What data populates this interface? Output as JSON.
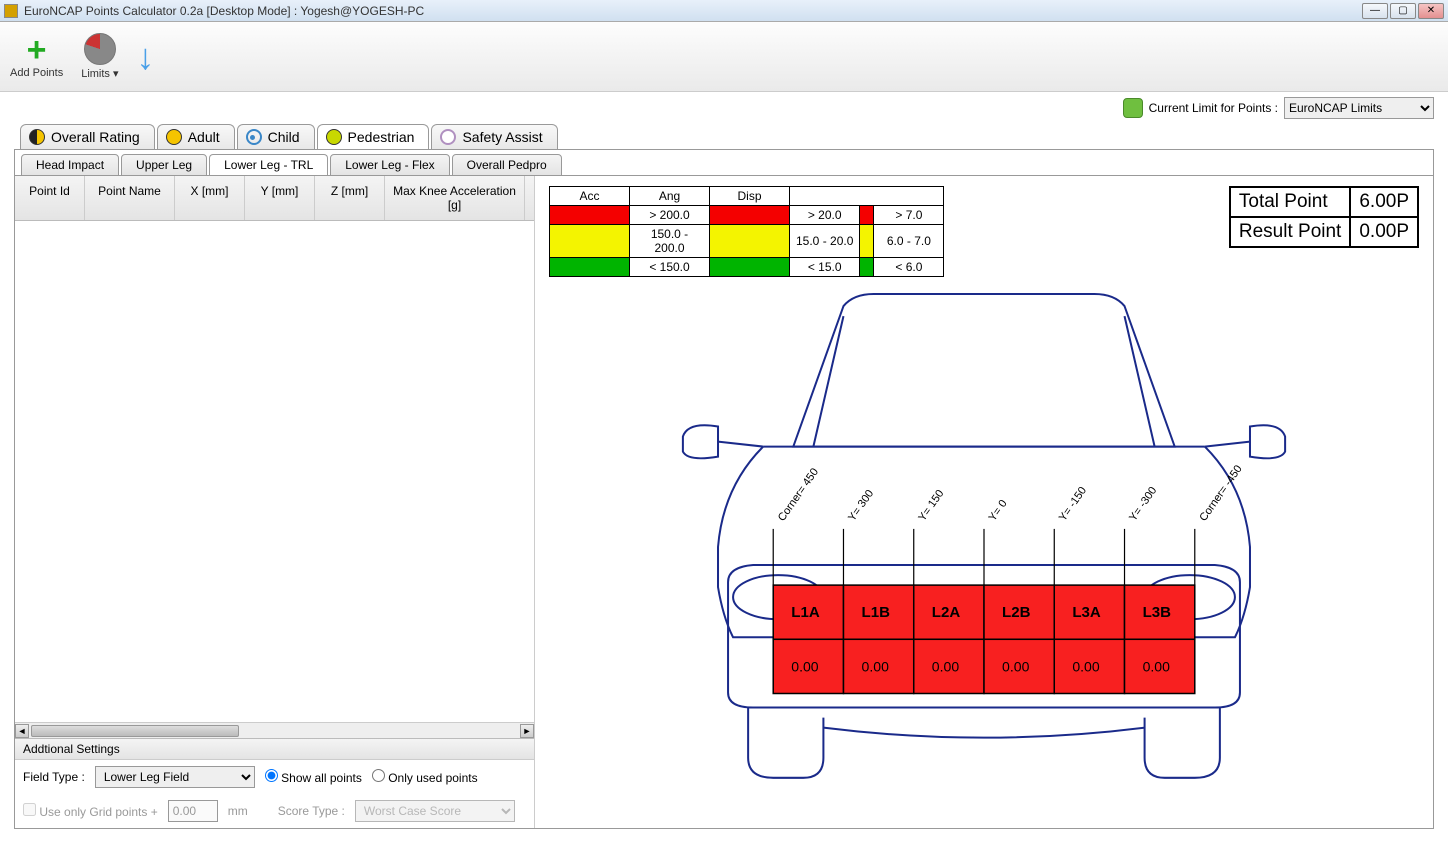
{
  "window": {
    "title": "EuroNCAP Points Calculator 0.2a [Desktop Mode] : Yogesh@YOGESH-PC"
  },
  "toolbar": {
    "addPoints": "Add Points",
    "limits": "Limits",
    "downArrow": ""
  },
  "limitSelector": {
    "label": "Current Limit for Points :",
    "selected": "EuroNCAP Limits"
  },
  "mainTabs": {
    "overall": "Overall Rating",
    "adult": "Adult",
    "child": "Child",
    "pedestrian": "Pedestrian",
    "safetyAssist": "Safety Assist"
  },
  "subTabs": {
    "headImpact": "Head Impact",
    "upperLeg": "Upper Leg",
    "lowerLegTRL": "Lower Leg - TRL",
    "lowerLegFlex": "Lower Leg - Flex",
    "overallPedpro": "Overall Pedpro"
  },
  "grid": {
    "cols": {
      "pointId": "Point Id",
      "pointName": "Point Name",
      "x": "X [mm]",
      "y": "Y [mm]",
      "z": "Z [mm]",
      "maxKnee": "Max Knee Acceleration [g]"
    }
  },
  "settings": {
    "header": "Addtional Settings",
    "fieldTypeLabel": "Field Type  :",
    "fieldTypeValue": "Lower Leg Field",
    "showAll": "Show all points",
    "onlyUsed": "Only used points",
    "useGrid": "Use only Grid points +",
    "gridNum": "0.00",
    "mm": "mm",
    "scoreTypeLabel": "Score Type :",
    "scoreTypeValue": "Worst Case Score"
  },
  "legend": {
    "hdr": {
      "acc": "Acc",
      "ang": "Ang",
      "disp": "Disp"
    },
    "rows": [
      {
        "color": "red",
        "acc": "> 200.0",
        "ang": "> 20.0",
        "disp": "> 7.0"
      },
      {
        "color": "yel",
        "acc": "150.0 - 200.0",
        "ang": "15.0 - 20.0",
        "disp": "6.0 - 7.0"
      },
      {
        "color": "grn",
        "acc": "< 150.0",
        "ang": "< 15.0",
        "disp": "< 6.0"
      }
    ]
  },
  "points": {
    "totalLabel": "Total Point",
    "totalValue": "6.00P",
    "resultLabel": "Result Point",
    "resultValue": "0.00P"
  },
  "carGrid": {
    "columns": [
      {
        "label": "Corner= 450"
      },
      {
        "label": "Y= 300"
      },
      {
        "label": "Y= 150"
      },
      {
        "label": "Y= 0"
      },
      {
        "label": "Y= -150"
      },
      {
        "label": "Y= -300"
      },
      {
        "label": "Corner= -450"
      }
    ],
    "zones": [
      {
        "name": "L1A",
        "value": "0.00"
      },
      {
        "name": "L1B",
        "value": "0.00"
      },
      {
        "name": "L2A",
        "value": "0.00"
      },
      {
        "name": "L2B",
        "value": "0.00"
      },
      {
        "name": "L3A",
        "value": "0.00"
      },
      {
        "name": "L3B",
        "value": "0.00"
      }
    ]
  }
}
